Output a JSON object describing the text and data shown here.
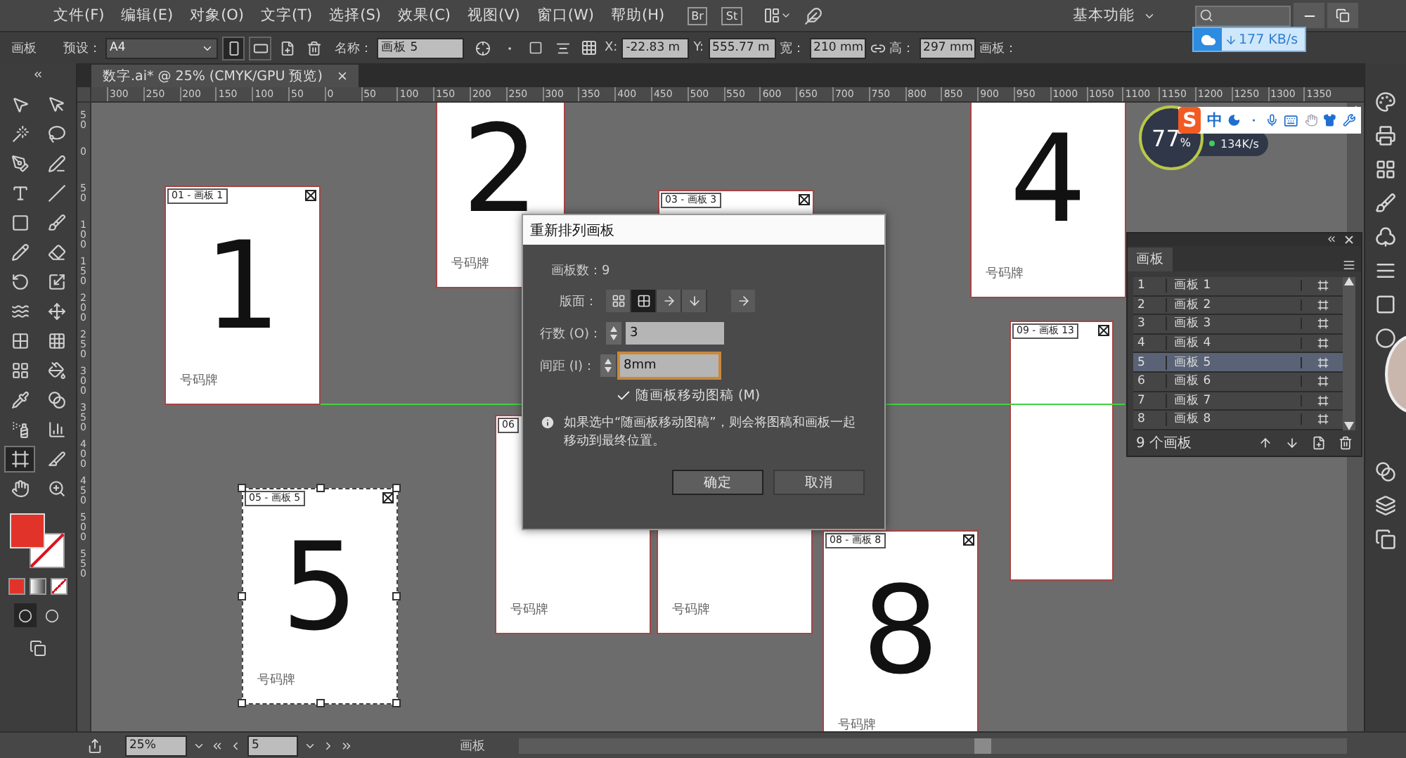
{
  "menu": {
    "items": [
      "文件(F)",
      "编辑(E)",
      "对象(O)",
      "文字(T)",
      "选择(S)",
      "效果(C)",
      "视图(V)",
      "窗口(W)",
      "帮助(H)"
    ],
    "badges": [
      "Br",
      "St"
    ],
    "workspace": "基本功能"
  },
  "control_bar": {
    "title": "画板",
    "preset_label": "预设：",
    "preset_value": "A4",
    "orientation": [
      {
        "kind": "portrait",
        "selected": true
      },
      {
        "kind": "landscape",
        "selected": false
      }
    ],
    "name_label": "名称：",
    "name_value": "画板 5",
    "x_label": "X:",
    "x_value": "-22.83 m",
    "y_label": "Y:",
    "y_value": "555.77 m",
    "width_label": "宽：",
    "width_value": "210 mm",
    "height_label": "高：",
    "height_value": "297 mm",
    "artboard_label": "画板："
  },
  "document_tab": {
    "title": "数字.ai* @ 25% (CMYK/GPU 预览)",
    "close": "×"
  },
  "ruler": {
    "horizontal": [
      "300",
      "250",
      "200",
      "150",
      "100",
      "50",
      "0",
      "50",
      "100",
      "150",
      "200",
      "250",
      "300",
      "350",
      "400",
      "450",
      "500",
      "550",
      "600",
      "650",
      "700",
      "750",
      "800",
      "850",
      "900",
      "950",
      "1000",
      "1050",
      "1100",
      "1150",
      "1200",
      "1250",
      "1300",
      "1350"
    ],
    "vertical": [
      "50",
      "0",
      "50",
      "100",
      "150",
      "200",
      "250",
      "300",
      "350",
      "400",
      "450",
      "500",
      "550"
    ]
  },
  "tools": [
    {
      "kind": "select",
      "selected": false
    },
    {
      "kind": "direct-select",
      "selected": false
    },
    {
      "kind": "magic-wand",
      "selected": false
    },
    {
      "kind": "lasso",
      "selected": false
    },
    {
      "kind": "pen",
      "selected": false
    },
    {
      "kind": "curvature",
      "selected": false
    },
    {
      "kind": "type",
      "selected": false
    },
    {
      "kind": "line",
      "selected": false
    },
    {
      "kind": "rectangle",
      "selected": false
    },
    {
      "kind": "paintbrush",
      "selected": false
    },
    {
      "kind": "pencil",
      "selected": false
    },
    {
      "kind": "eraser",
      "selected": false
    },
    {
      "kind": "rotate",
      "selected": false
    },
    {
      "kind": "scale",
      "selected": false
    },
    {
      "kind": "warp",
      "selected": false
    },
    {
      "kind": "free-transform",
      "selected": false
    },
    {
      "kind": "shape-builder",
      "selected": false
    },
    {
      "kind": "perspective",
      "selected": false
    },
    {
      "kind": "mesh",
      "selected": false
    },
    {
      "kind": "gradient",
      "selected": false
    },
    {
      "kind": "eyedropper",
      "selected": false
    },
    {
      "kind": "blend",
      "selected": false
    },
    {
      "kind": "symbol-sprayer",
      "selected": false
    },
    {
      "kind": "graph",
      "selected": false
    },
    {
      "kind": "artboard",
      "selected": true
    },
    {
      "kind": "slice",
      "selected": false
    },
    {
      "kind": "hand",
      "selected": false
    },
    {
      "kind": "zoom",
      "selected": false
    }
  ],
  "artboards": [
    {
      "label": "01 - 画板 1",
      "number": "1",
      "footer": "号码牌",
      "selected": false
    },
    {
      "number": "2",
      "footer": "号码牌",
      "selected": false
    },
    {
      "label": "03 - 画板 3",
      "selected": false
    },
    {
      "number": "4",
      "footer": "号码牌",
      "selected": false
    },
    {
      "label": "05 - 画板 5",
      "number": "5",
      "footer": "号码牌",
      "selected": true
    },
    {
      "label": "06",
      "footer": "号码牌",
      "selected": false
    },
    {
      "footer": "号码牌",
      "selected": false
    },
    {
      "label": "08 - 画板 8",
      "number": "8",
      "footer": "号码牌",
      "selected": false
    },
    {
      "label": "09 - 画板 13",
      "selected": false
    }
  ],
  "dialog": {
    "title": "重新排列画板",
    "count": "画板数：9",
    "layout_label": "版面：",
    "layout_options": [
      {
        "kind": "grid-by-row",
        "selected": false
      },
      {
        "kind": "grid-by-column",
        "selected": true
      },
      {
        "kind": "row",
        "selected": false
      },
      {
        "kind": "column",
        "selected": false
      }
    ],
    "rows_label": "行数 (O)：",
    "rows_value": "3",
    "spacing_label": "间距 (I)：",
    "spacing_value": "8mm",
    "move_artwork": {
      "label": "随画板移动图稿 (M)",
      "checked": true
    },
    "info": "如果选中“随画板移动图稿”，则会将图稿和画板一起移动到最终位置。",
    "buttons": [
      "确定",
      "取消"
    ]
  },
  "artboards_panel": {
    "title": "画板",
    "rows": [
      {
        "index": "1",
        "name": "画板 1",
        "selected": false
      },
      {
        "index": "2",
        "name": "画板 2",
        "selected": false
      },
      {
        "index": "3",
        "name": "画板 3",
        "selected": false
      },
      {
        "index": "4",
        "name": "画板 4",
        "selected": false
      },
      {
        "index": "5",
        "name": "画板 5",
        "selected": true
      },
      {
        "index": "6",
        "name": "画板 6",
        "selected": false
      },
      {
        "index": "7",
        "name": "画板 7",
        "selected": false
      },
      {
        "index": "8",
        "name": "画板 8",
        "selected": false
      }
    ],
    "footer": "9 个画板"
  },
  "status_bar": {
    "zoom": "25%",
    "artboard": "5",
    "mode": "画板"
  },
  "overlays": {
    "net_monitor": {
      "percent": "77",
      "unit": "%",
      "speed": "134K/s"
    },
    "ime": {
      "logo": "S",
      "mode": "中"
    },
    "download": {
      "speed": "177 KB/s"
    }
  }
}
